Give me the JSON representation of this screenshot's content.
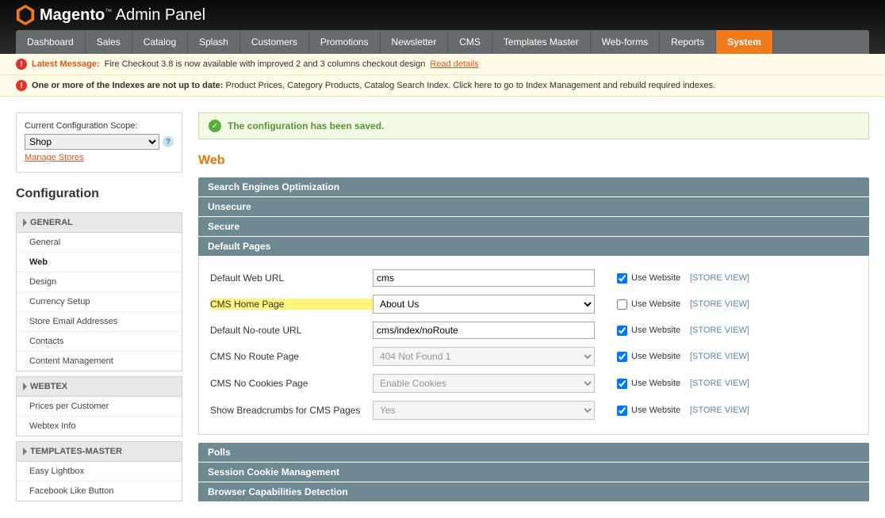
{
  "header": {
    "brand": "Magento",
    "title": "Admin Panel"
  },
  "nav": {
    "items": [
      {
        "label": "Dashboard"
      },
      {
        "label": "Sales"
      },
      {
        "label": "Catalog"
      },
      {
        "label": "Splash"
      },
      {
        "label": "Customers"
      },
      {
        "label": "Promotions"
      },
      {
        "label": "Newsletter"
      },
      {
        "label": "CMS"
      },
      {
        "label": "Templates Master"
      },
      {
        "label": "Web-forms"
      },
      {
        "label": "Reports"
      },
      {
        "label": "System"
      }
    ],
    "active": "System"
  },
  "messages": {
    "latest_label": "Latest Message:",
    "latest_text": "Fire Checkout 3.8 is now available with improved 2 and 3 columns checkout design",
    "latest_link": "Read details",
    "index_prefix": "One or more of the Indexes are not up to date:",
    "index_text": "Product Prices, Category Products, Catalog Search Index. Click here to go to",
    "index_link": "Index Management",
    "index_suffix": "and rebuild required indexes."
  },
  "scope": {
    "label": "Current Configuration Scope:",
    "value": "Shop",
    "manage_link": "Manage Stores"
  },
  "config_title": "Configuration",
  "categories": [
    {
      "label": "GENERAL",
      "items": [
        "General",
        "Web",
        "Design",
        "Currency Setup",
        "Store Email Addresses",
        "Contacts",
        "Content Management"
      ],
      "active": "Web"
    },
    {
      "label": "WEBTEX",
      "items": [
        "Prices per Customer",
        "Webtex Info"
      ]
    },
    {
      "label": "TEMPLATES-MASTER",
      "items": [
        "Easy Lightbox",
        "Facebook Like Button"
      ]
    }
  ],
  "success_text": "The configuration has been saved.",
  "page_title": "Web",
  "sections": [
    "Search Engines Optimization",
    "Unsecure",
    "Secure",
    "Default Pages"
  ],
  "fields": {
    "default_web_url": {
      "label": "Default Web URL",
      "value": "cms",
      "scope": "[STORE VIEW]",
      "use_label": "Use Website",
      "checked": true
    },
    "cms_home_page": {
      "label": "CMS Home Page",
      "value": "About Us",
      "scope": "[STORE VIEW]",
      "use_label": "Use Website",
      "checked": false
    },
    "default_noroute_url": {
      "label": "Default No-route URL",
      "value": "cms/index/noRoute",
      "scope": "[STORE VIEW]",
      "use_label": "Use Website",
      "checked": true
    },
    "cms_noroute_page": {
      "label": "CMS No Route Page",
      "value": "404 Not Found 1",
      "scope": "[STORE VIEW]",
      "use_label": "Use Website",
      "checked": true
    },
    "cms_nocookies_page": {
      "label": "CMS No Cookies Page",
      "value": "Enable Cookies",
      "scope": "[STORE VIEW]",
      "use_label": "Use Website",
      "checked": true
    },
    "show_breadcrumbs": {
      "label": "Show Breadcrumbs for CMS Pages",
      "value": "Yes",
      "scope": "[STORE VIEW]",
      "use_label": "Use Website",
      "checked": true
    }
  },
  "lower_sections": [
    "Polls",
    "Session Cookie Management",
    "Browser Capabilities Detection"
  ]
}
